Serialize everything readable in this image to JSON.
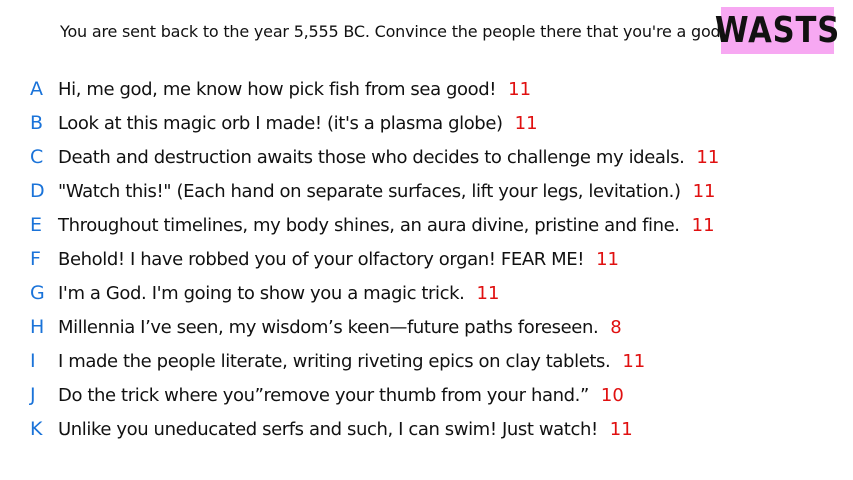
{
  "prompt": "You are sent back to the year 5,555 BC. Convince the people there that you're a god.",
  "logo": "WASTS",
  "colors": {
    "letter": "#1a73d9",
    "score": "#e01010",
    "logo_bg": "#f7a8f2"
  },
  "answers": [
    {
      "letter": "A",
      "text": "Hi, me god, me know how pick fish from sea good!",
      "score": "11"
    },
    {
      "letter": "B",
      "text": "Look at this magic orb I made! (it's a plasma globe)",
      "score": "11"
    },
    {
      "letter": "C",
      "text": "Death and destruction awaits those who decides to challenge my ideals.",
      "score": "11"
    },
    {
      "letter": "D",
      "text": "\"Watch this!\" (Each hand on separate surfaces, lift your legs, levitation.)",
      "score": "11"
    },
    {
      "letter": "E",
      "text": "Throughout timelines, my body shines, an aura divine, pristine and fine.",
      "score": "11"
    },
    {
      "letter": "F",
      "text": "Behold! I have robbed you of your olfactory organ! FEAR ME!",
      "score": "11"
    },
    {
      "letter": "G",
      "text": "I'm a God. I'm going to show you a magic trick.",
      "score": "11"
    },
    {
      "letter": "H",
      "text": "Millennia I’ve seen, my wisdom’s keen—future paths foreseen.",
      "score": "8"
    },
    {
      "letter": "I",
      "text": "I made the people literate, writing riveting epics on clay tablets.",
      "score": "11"
    },
    {
      "letter": "J",
      "text": "Do the trick where you”remove your thumb from your hand.”",
      "score": "10"
    },
    {
      "letter": "K",
      "text": "Unlike you uneducated serfs and such, I can swim! Just watch!",
      "score": "11"
    }
  ]
}
